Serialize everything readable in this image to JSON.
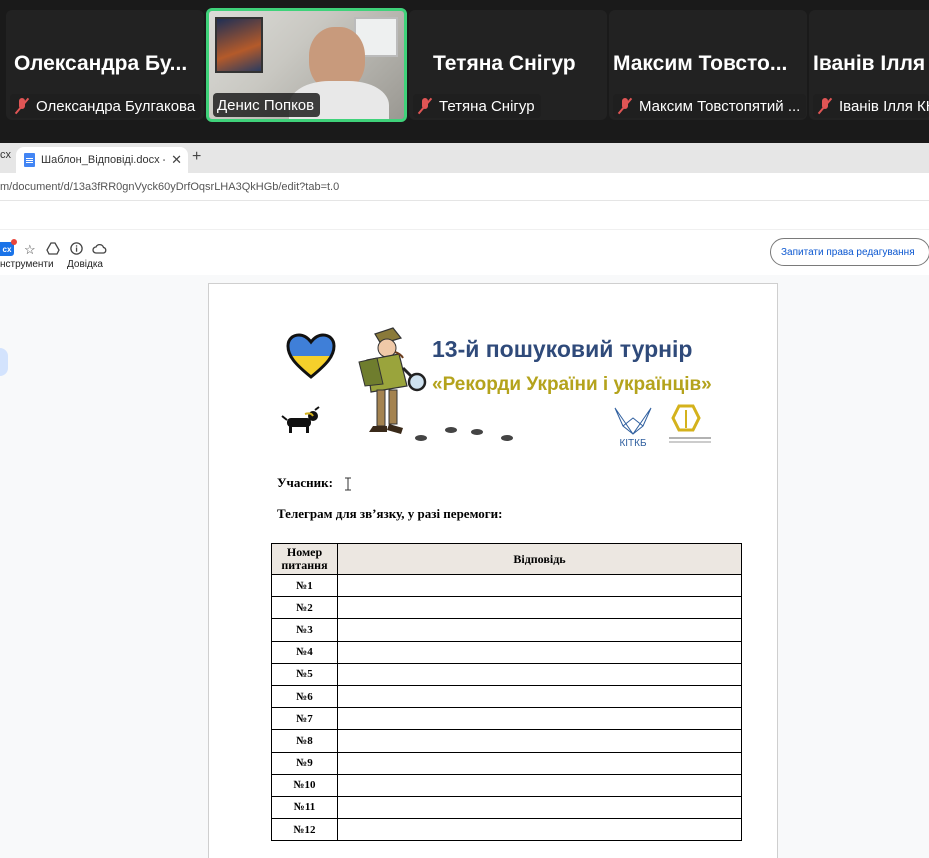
{
  "call": {
    "participants": [
      {
        "big_name": "Олександра  Бу...",
        "label": "Олександра Булгакова",
        "muted": true
      },
      {
        "big_name": "",
        "label": "Денис Попков",
        "muted": false,
        "speaking": true
      },
      {
        "big_name": "Тетяна Снігур",
        "label": "Тетяна Снігур",
        "muted": true
      },
      {
        "big_name": "Максим  Товсто...",
        "label": "Максим Товстопятий ...",
        "muted": true
      },
      {
        "big_name": "Іванів Ілля",
        "label": "Іванів Ілля КН",
        "muted": true
      }
    ]
  },
  "browser": {
    "prev_tab": "cx",
    "tab_title": "Шаблон_Відповіді.docx - Goog",
    "url": "m/document/d/13a3fRR0gnVyck60yDrfOqsrLHA3QkHGb/edit?tab=t.0"
  },
  "docs": {
    "badge": "cx",
    "menu": [
      "нструменти",
      "Довідка"
    ],
    "ask_button": "Запитати права редагування"
  },
  "document": {
    "banner_title": "13-й пошуковий турнір",
    "banner_subtitle": "«Рекорди України і українців»",
    "logo_text": "КІТКБ",
    "participant_label": "Учасник:",
    "telegram_label": "Телеграм для зв’язку, у разі перемоги:",
    "table": {
      "header_num": "Номер питання",
      "header_answer": "Відповідь",
      "rows": [
        "№1",
        "№2",
        "№3",
        "№4",
        "№5",
        "№6",
        "№7",
        "№8",
        "№9",
        "№10",
        "№11",
        "№12"
      ]
    }
  },
  "colors": {
    "speaking_border": "#3fd27a",
    "muted_icon": "#e05555",
    "title_blue": "#2f4a7a",
    "title_olive": "#b4a31c",
    "table_header": "#ece7e1",
    "link_blue": "#0b57d0"
  }
}
